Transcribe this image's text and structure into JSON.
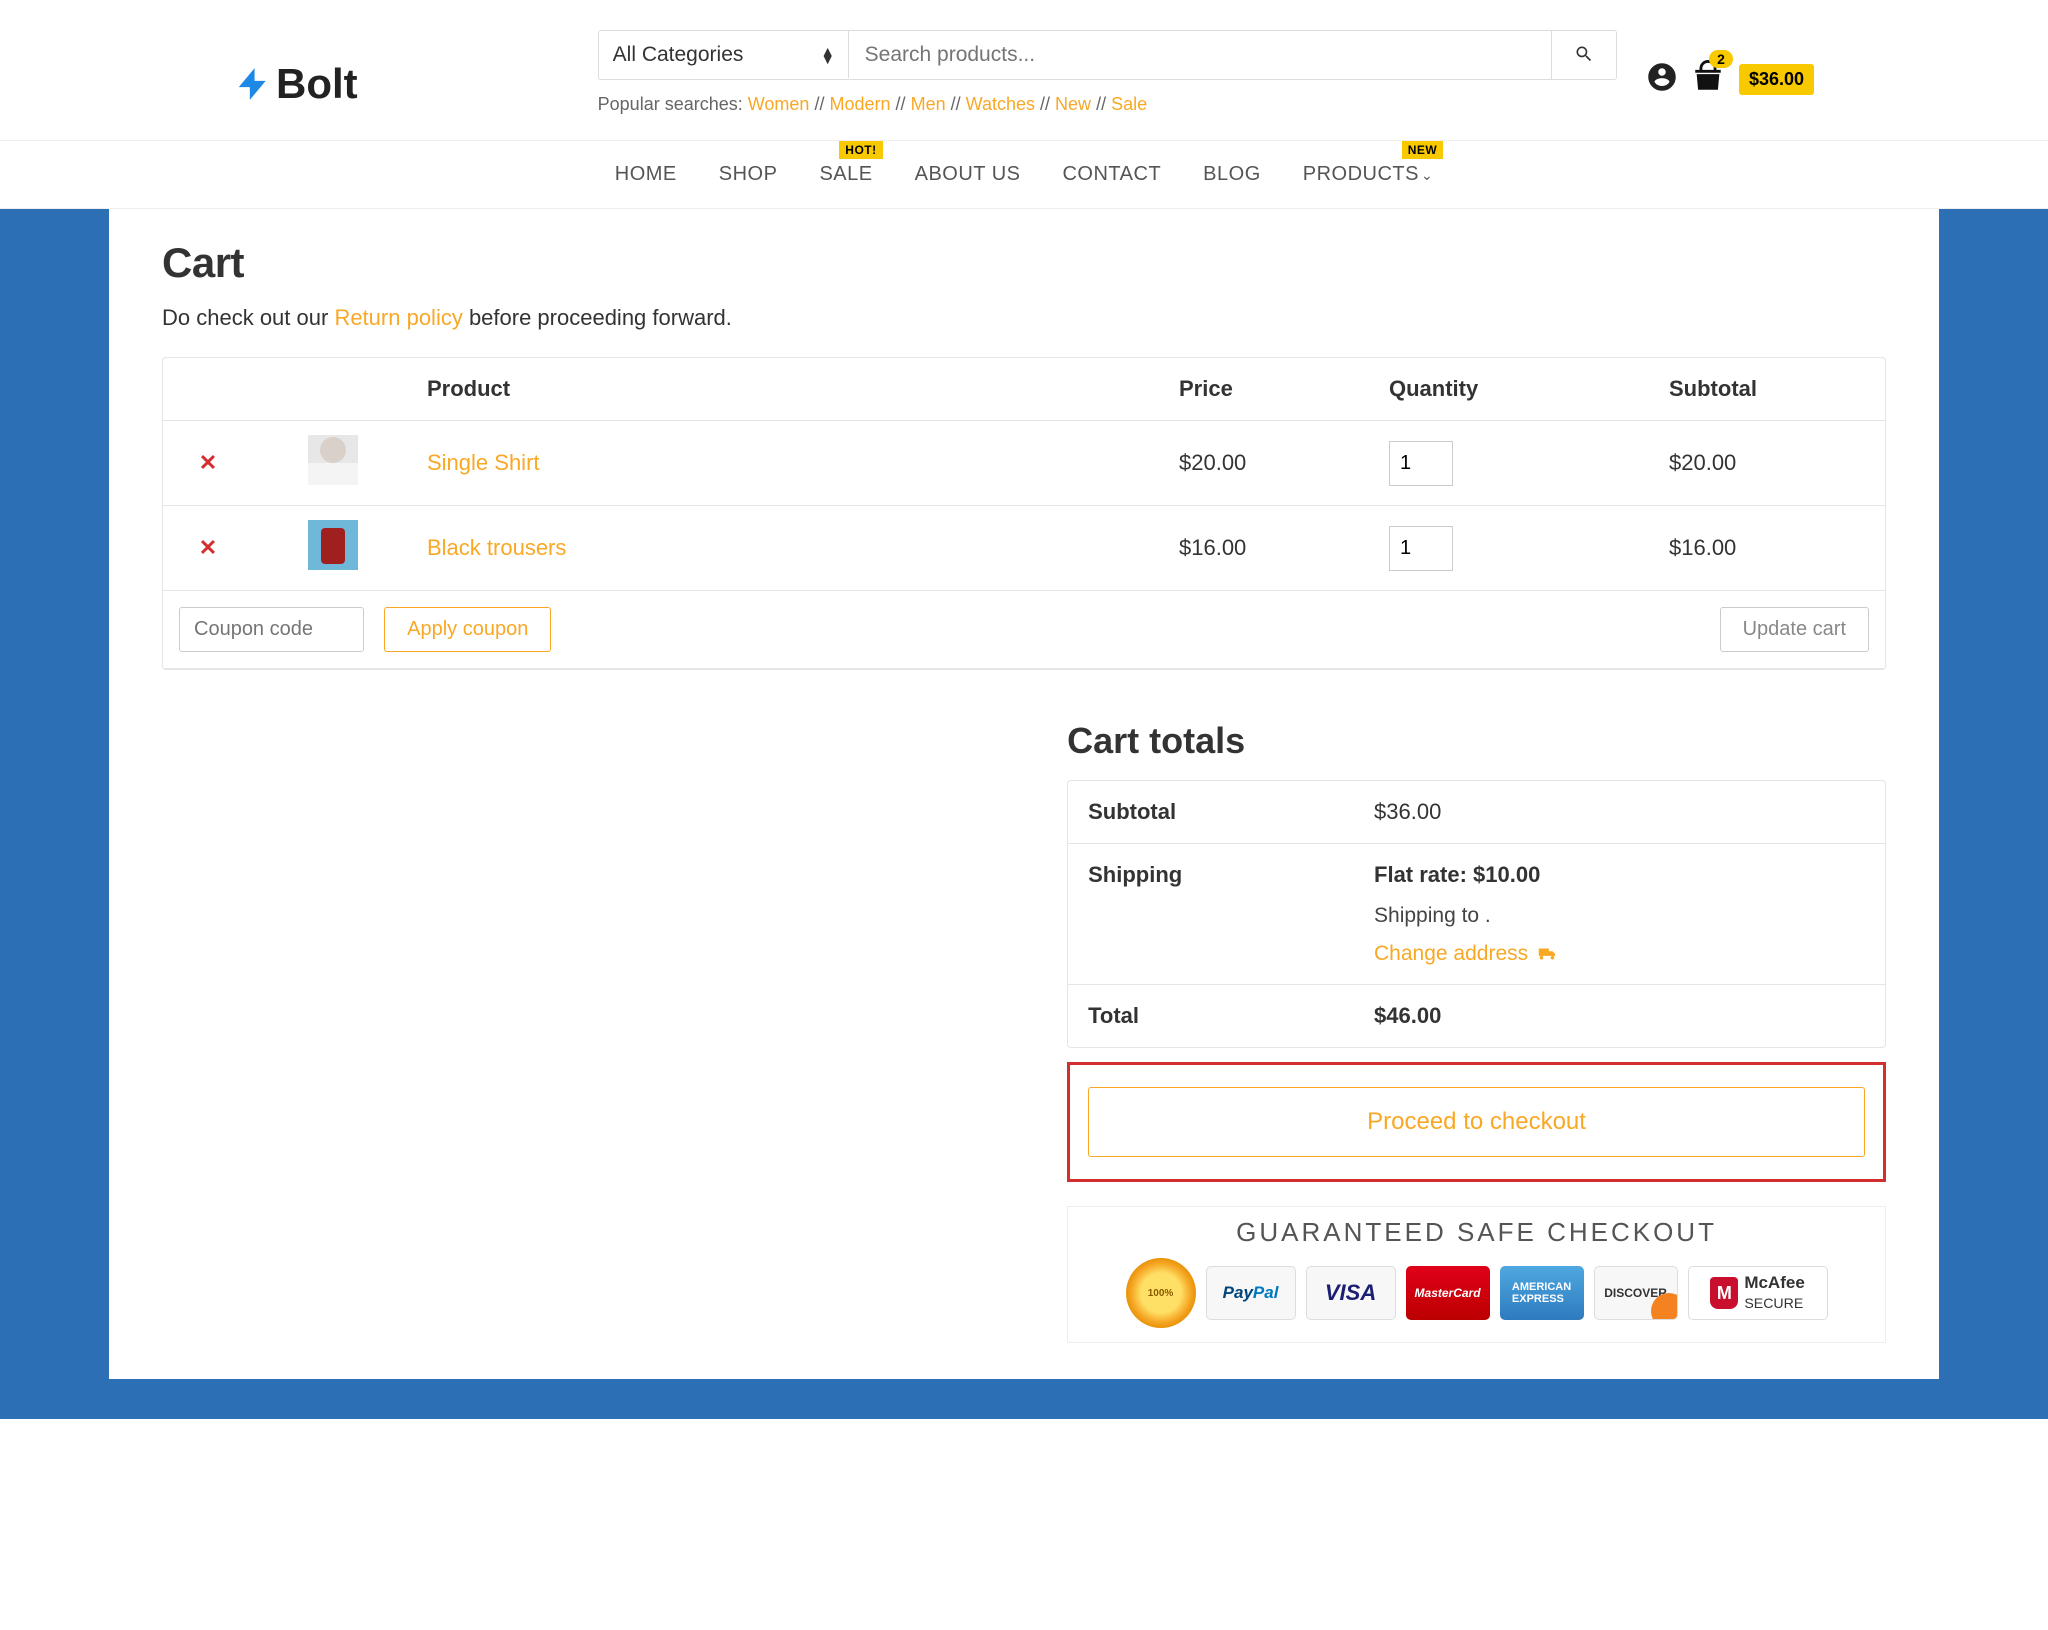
{
  "logo": "Bolt",
  "search": {
    "category": "All Categories",
    "placeholder": "Search products..."
  },
  "popular": {
    "label": "Popular searches: ",
    "links": [
      "Women",
      "Modern",
      "Men",
      "Watches",
      "New",
      "Sale"
    ]
  },
  "header_cart": {
    "badge": "2",
    "total": "$36.00"
  },
  "nav": {
    "items": [
      "HOME",
      "SHOP",
      "SALE",
      "ABOUT US",
      "CONTACT",
      "BLOG",
      "PRODUCTS"
    ],
    "sale_tag": "HOT!",
    "products_tag": "NEW"
  },
  "page": {
    "title": "Cart",
    "return_pre": "Do check out our ",
    "return_link": "Return policy",
    "return_post": " before proceeding forward."
  },
  "cart": {
    "headers": {
      "product": "Product",
      "price": "Price",
      "qty": "Quantity",
      "subtotal": "Subtotal"
    },
    "items": [
      {
        "name": "Single Shirt",
        "price": "$20.00",
        "qty": "1",
        "subtotal": "$20.00"
      },
      {
        "name": "Black trousers",
        "price": "$16.00",
        "qty": "1",
        "subtotal": "$16.00"
      }
    ],
    "coupon_placeholder": "Coupon code",
    "apply": "Apply coupon",
    "update": "Update cart"
  },
  "totals": {
    "title": "Cart totals",
    "subtotal_label": "Subtotal",
    "subtotal": "$36.00",
    "shipping_label": "Shipping",
    "flat_rate": "Flat rate: $10.00",
    "shipping_to": "Shipping to   .",
    "change": "Change address",
    "total_label": "Total",
    "total": "$46.00"
  },
  "checkout_btn": "Proceed to checkout",
  "safe": {
    "title": "GUARANTEED SAFE CHECKOUT"
  }
}
